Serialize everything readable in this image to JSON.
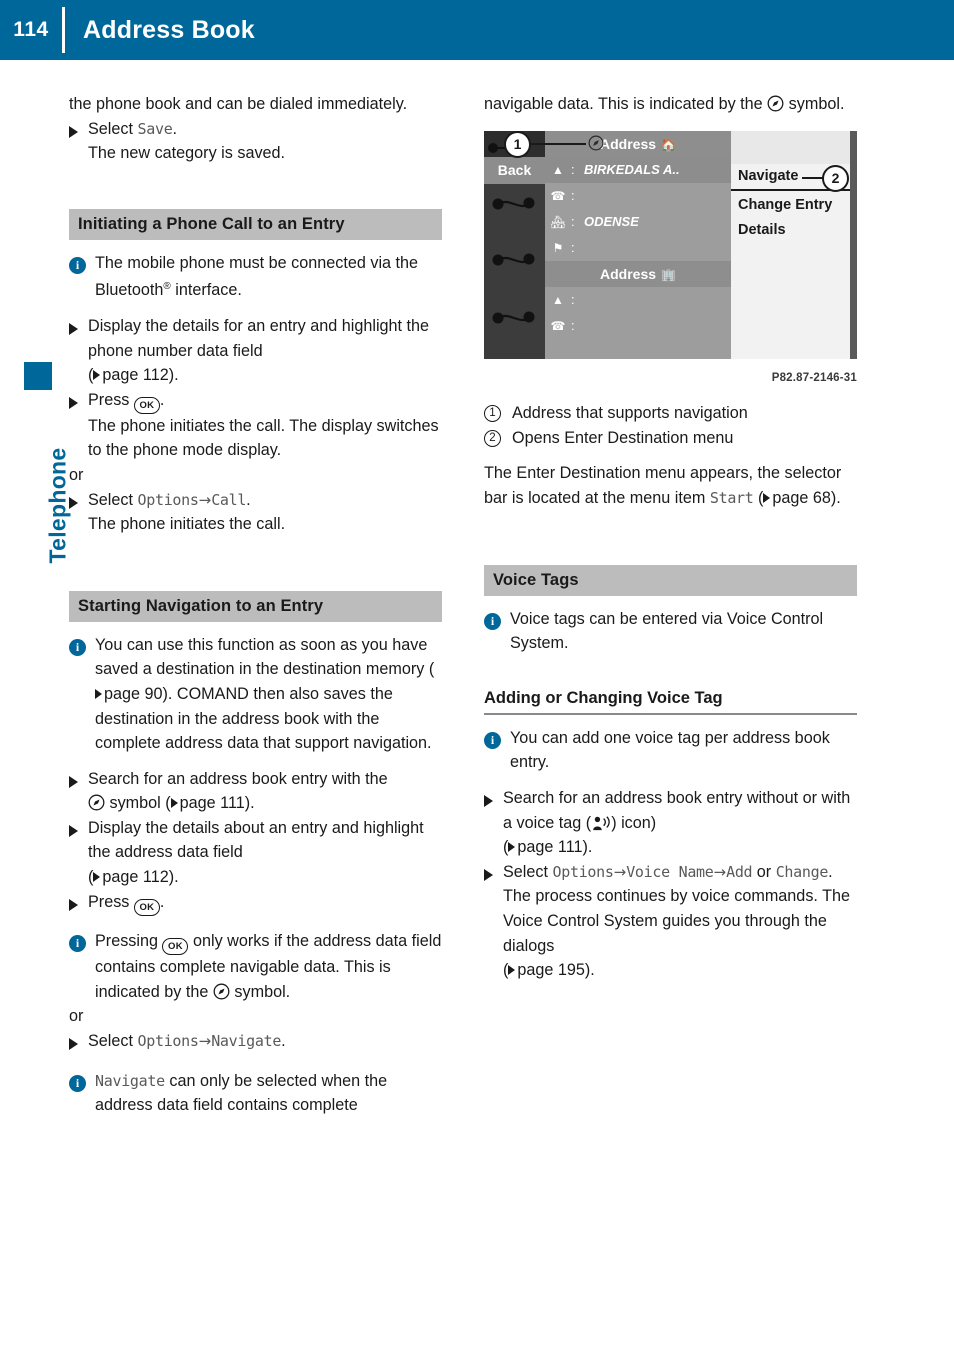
{
  "header": {
    "page_number": "114",
    "title": "Address Book",
    "bg_color": "#00679a"
  },
  "side_tab": {
    "label": "Telephone",
    "color": "#00679a"
  },
  "left_column": {
    "intro": {
      "line1": "the phone book and can be dialed",
      "line2": "immediately."
    },
    "step_save": {
      "prefix": "Select ",
      "mono": "Save",
      "suffix": ".",
      "result": "The new category is saved."
    },
    "section1": {
      "heading": "Initiating a Phone Call to an Entry",
      "note1_part1": "The mobile phone must be connected via the Bluetooth",
      "note1_sup": "®",
      "note1_part2": " interface.",
      "step1": "Display the details for an entry and highlight the phone number data field",
      "step1_ref": "page 112",
      "step2_prefix": "Press ",
      "step2_key": "OK",
      "step2_suffix": ".",
      "step2_result": "The phone initiates the call. The display switches to the phone mode display.",
      "or": "or",
      "step3_prefix": "Select ",
      "step3_mono1": "Options",
      "step3_arrow": "→",
      "step3_mono2": "Call",
      "step3_suffix": ".",
      "step3_result": "The phone initiates the call."
    },
    "section2": {
      "heading": "Starting Navigation to an Entry",
      "note1_part1": "You can use this function as soon as you have saved a destination in the destination memory (",
      "note1_ref": "page 90",
      "note1_part2": "). COMAND then also saves the destination in the address book with the complete address data that support navigation.",
      "step1_part1": "Search for an address book entry with the",
      "step1_part2": " symbol (",
      "step1_ref": "page 111",
      "step1_part3": ").",
      "step2": "Display the details about an entry and highlight the address data field",
      "step2_ref": "page 112",
      "step3_prefix": "Press ",
      "step3_key": "OK",
      "step3_suffix": ".",
      "note2_part1": "Pressing ",
      "note2_key": "OK",
      "note2_part2": " only works if the address data field contains complete navigable data. This is indicated by the",
      "note2_part3": " symbol.",
      "or": "or",
      "step4_prefix": "Select ",
      "step4_mono1": "Options",
      "step4_arrow": "→",
      "step4_mono2": "Navigate",
      "step4_suffix": ".",
      "note3_mono": "Navigate",
      "note3_text": " can only be selected when the address data field contains complete"
    }
  },
  "right_column": {
    "continuation": {
      "part1": "navigable data. This is indicated by the",
      "part2": " symbol."
    },
    "figure": {
      "code": "P82.87-2146-31",
      "back_label": "Back",
      "header1": "Address",
      "header2": "Address",
      "rows": [
        {
          "icon": "street",
          "value": "BIRKEDALS A..",
          "selected": true
        },
        {
          "icon": "phone",
          "value": ""
        },
        {
          "icon": "city",
          "value": "ODENSE"
        },
        {
          "icon": "flag",
          "value": ""
        }
      ],
      "rows2": [
        {
          "icon": "street",
          "value": ""
        },
        {
          "icon": "phone",
          "value": ""
        }
      ],
      "menu_items": [
        "Navigate",
        "Change Entry",
        "Details"
      ],
      "callouts": [
        "1",
        "2"
      ]
    },
    "legend": [
      {
        "num": "1",
        "text": "Address that supports navigation"
      },
      {
        "num": "2",
        "text": "Opens Enter Destination menu"
      }
    ],
    "after_legend": {
      "part1": "The Enter Destination menu appears, the selector bar is located at the menu item",
      "mono": "Start",
      "part2": " (",
      "ref": "page 68",
      "part3": ")."
    },
    "section_voice_tags": {
      "heading": "Voice Tags",
      "note1": "Voice tags can be entered via Voice Control System."
    },
    "subsection_adding": {
      "heading": "Adding or Changing Voice Tag",
      "note1": "You can add one voice tag per address book entry.",
      "step1_part1": "Search for an address book entry without or with a voice tag (",
      "step1_part2": ") icon)",
      "step1_ref": "page 111",
      "step2_prefix": "Select ",
      "step2_mono1": "Options",
      "step2_arrow1": "→",
      "step2_mono2": "Voice Name",
      "step2_arrow2": "→",
      "step2_mono3": "Add",
      "step2_or": " or ",
      "step2_mono4": "Change",
      "step2_suffix": ".",
      "step2_result": "The process continues by voice commands. The Voice Control System guides you through the dialogs",
      "step2_ref": "page 195"
    }
  }
}
